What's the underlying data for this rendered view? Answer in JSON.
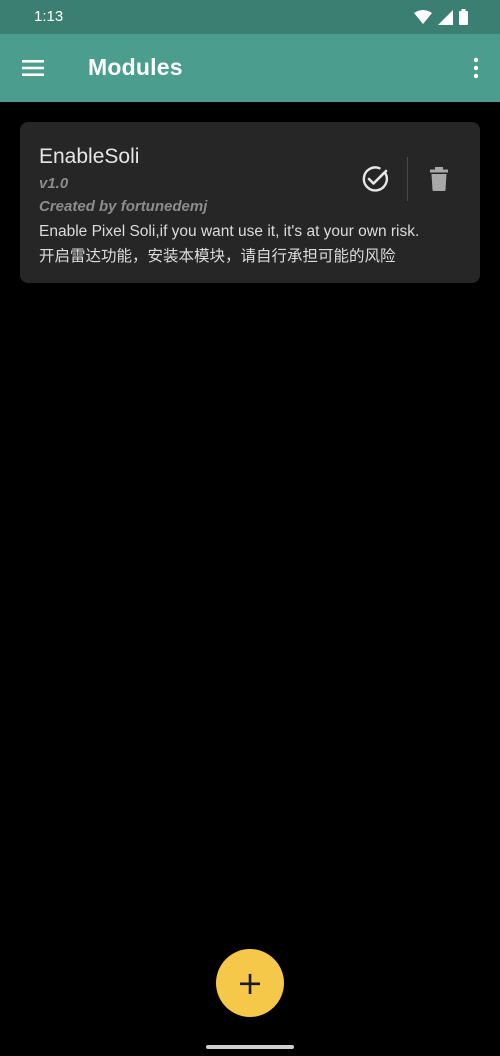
{
  "status_bar": {
    "time": "1:13",
    "icons": [
      "wifi-icon",
      "signal-icon",
      "battery-icon"
    ]
  },
  "app_bar": {
    "title": "Modules",
    "menu_icon": "hamburger-menu-icon",
    "overflow_icon": "more-vert-icon"
  },
  "modules": [
    {
      "name": "EnableSoli",
      "version": "v1.0",
      "author": "Created by fortunedemj",
      "description_line1": "Enable Pixel Soli,if you want use it, it's at your own risk.",
      "description_line2": "开启雷达功能，安装本模块，请自行承担可能的风险",
      "enabled": true,
      "toggle_icon": "check-circle-icon",
      "remove_icon": "trash-icon"
    }
  ],
  "fab": {
    "label": "+",
    "icon": "add-icon"
  },
  "colors": {
    "status_bar": "#3a7f71",
    "app_bar": "#4b9d8d",
    "card": "#262626",
    "fab": "#f5c84a",
    "background": "#000000"
  }
}
